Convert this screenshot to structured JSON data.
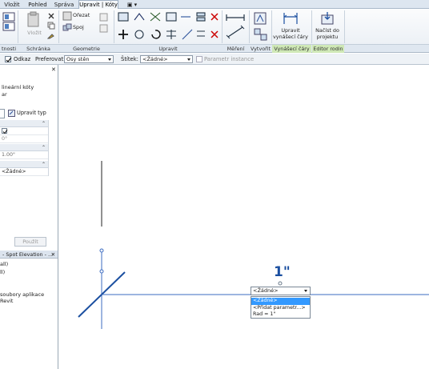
{
  "tabs": [
    "Vložit",
    "Pohled",
    "Správa",
    "Upravit | Kóty",
    "▣ ▾"
  ],
  "panels": {
    "vlastnosti": "tnosti",
    "schranka": "Schránka",
    "geometrie": "Geometrie",
    "upravit": "Upravit",
    "mereni": "Měření",
    "vytvorit": "Vytvořit",
    "vynaseci_cary": "Vynášecí čáry",
    "editor_rodin": "Editor rodin"
  },
  "ribbon_buttons": {
    "vlozit": "Vložit",
    "orezat": "Ořezat",
    "spoj": "Spoj",
    "upravit_vynaseci": [
      "Upravit",
      "vynášecí čáry"
    ],
    "nacist": [
      "Načíst do",
      "projektu"
    ]
  },
  "options_bar": {
    "odkaz_label": "Odkaz",
    "odkaz_checked": true,
    "preferovat_label": "Preferovat:",
    "preferovat_value": "Osy stěn",
    "stitek_label": "Štítek:",
    "stitek_value": "<Žádné>",
    "parametr_instance_label": "Parametr instance"
  },
  "properties": {
    "type_line1": "lineární kóty",
    "type_line2": "ar",
    "edit_type": "Upravit typ",
    "row_zero": "0°",
    "row_value": "1.00\"",
    "row_tag": "<Žádné>",
    "apply_button": "Použít"
  },
  "browser": {
    "title": "- Spot Elevation - ...",
    "items": [
      "all)",
      "ll)",
      "",
      "soubory aplikace Revit"
    ]
  },
  "canvas": {
    "dimension_text": "1\"",
    "tag_dropdown_value": "<Žádné>",
    "dropdown_options": [
      "<Žádné>",
      "<Přidat parametr...>",
      "Rad = 1\""
    ],
    "selected_option_index": 0
  },
  "colors": {
    "dimension_blue": "#1b4fa0",
    "selection_blue": "#3399ff",
    "ribbon_bg": "#eef2f6",
    "green_panel": "#cfe8b6"
  }
}
